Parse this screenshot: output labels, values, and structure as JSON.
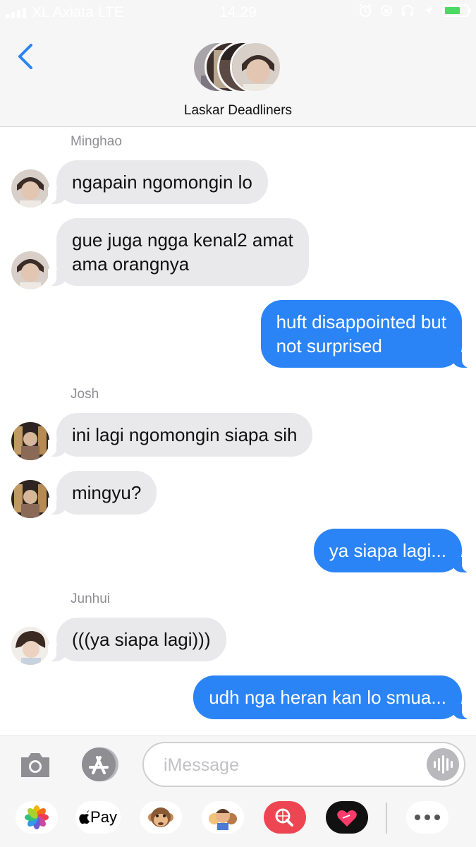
{
  "status_bar": {
    "carrier": "XL Axiata LTE",
    "time": "14.29"
  },
  "header": {
    "back_icon": "chevron-left-icon",
    "group_name": "Laskar Deadliners"
  },
  "colors": {
    "accent": "#2b84f6",
    "incoming_bubble": "#e9e9eb",
    "header_bg": "#f6f6f6"
  },
  "messages": [
    {
      "type": "sender",
      "text": "Minghao"
    },
    {
      "type": "incoming",
      "text": "ngapain ngomongin lo"
    },
    {
      "type": "incoming",
      "line1": "gue juga ngga kenal2 amat",
      "line2": "ama orangnya"
    },
    {
      "type": "outgoing",
      "line1": "huft disappointed but",
      "line2": "not surprised"
    },
    {
      "type": "sender",
      "text": "Josh"
    },
    {
      "type": "incoming",
      "text": "ini lagi ngomongin siapa sih"
    },
    {
      "type": "incoming",
      "text": "mingyu?"
    },
    {
      "type": "outgoing",
      "text": "ya siapa lagi..."
    },
    {
      "type": "sender",
      "text": "Junhui"
    },
    {
      "type": "incoming",
      "text": "(((ya siapa lagi)))"
    },
    {
      "type": "outgoing",
      "text": "udh nga heran kan lo smua..."
    }
  ],
  "input_bar": {
    "placeholder": "iMessage",
    "apps": [
      {
        "name": "photos"
      },
      {
        "name": "apple-pay",
        "label": "Pay"
      },
      {
        "name": "animoji"
      },
      {
        "name": "memoji"
      },
      {
        "name": "web-search"
      },
      {
        "name": "digital-touch"
      },
      {
        "name": "more"
      }
    ]
  }
}
